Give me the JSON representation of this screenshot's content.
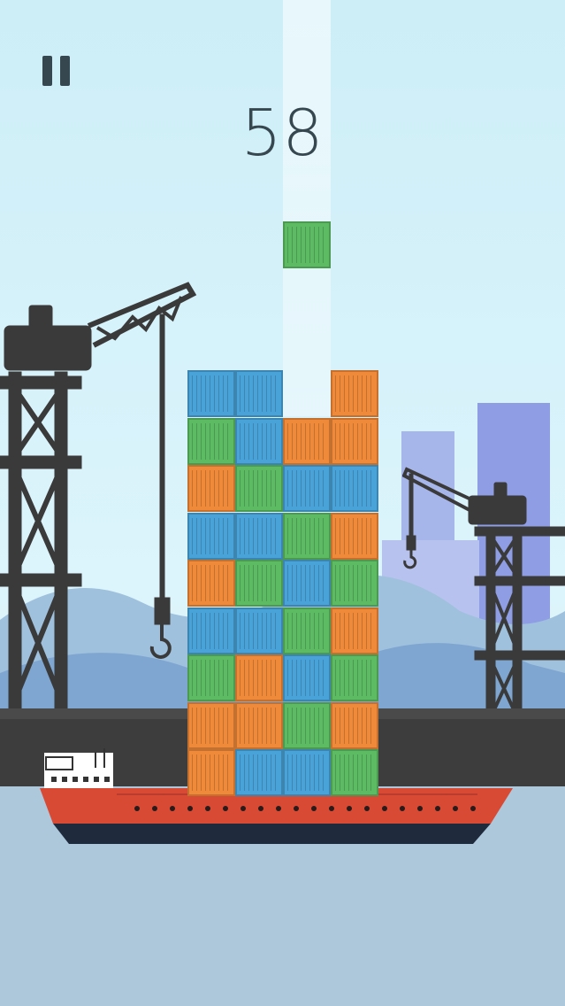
{
  "score": "58",
  "pause_icon": "pause-icon",
  "colors": {
    "blue": "#4aa3d8",
    "green": "#5dbb63",
    "orange": "#ef8a3a",
    "crane": "#3a3a3a",
    "ship_hull": "#d94a35"
  },
  "falling_container": "green",
  "stack": {
    "columns": 4,
    "rows_bottom_to_top": [
      [
        "orange",
        "blue",
        "blue",
        "green"
      ],
      [
        "orange",
        "orange",
        "green",
        "orange"
      ],
      [
        "green",
        "orange",
        "blue",
        "green"
      ],
      [
        "blue",
        "blue",
        "green",
        "orange"
      ],
      [
        "orange",
        "green",
        "blue",
        "green"
      ],
      [
        "blue",
        "blue",
        "green",
        "orange"
      ],
      [
        "orange",
        "green",
        "blue",
        "blue"
      ],
      [
        "green",
        "blue",
        "orange",
        "orange"
      ],
      [
        "blue",
        "blue",
        null,
        "orange"
      ]
    ]
  }
}
